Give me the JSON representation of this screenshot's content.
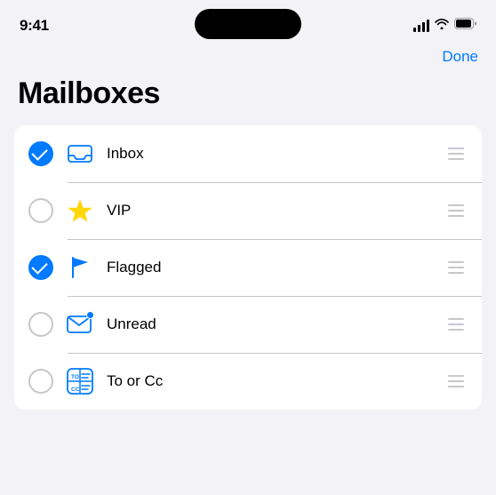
{
  "status": {
    "time": "9:41"
  },
  "nav": {
    "done_label": "Done"
  },
  "page": {
    "title": "Mailboxes"
  },
  "items": [
    {
      "id": "inbox",
      "label": "Inbox",
      "checked": true,
      "icon": "inbox",
      "has_dot": false
    },
    {
      "id": "vip",
      "label": "VIP",
      "checked": false,
      "icon": "star",
      "has_dot": false
    },
    {
      "id": "flagged",
      "label": "Flagged",
      "checked": true,
      "icon": "flag",
      "has_dot": false
    },
    {
      "id": "unread",
      "label": "Unread",
      "checked": false,
      "icon": "unread",
      "has_dot": true
    },
    {
      "id": "tocc",
      "label": "To or Cc",
      "checked": false,
      "icon": "tocc",
      "has_dot": false
    }
  ]
}
